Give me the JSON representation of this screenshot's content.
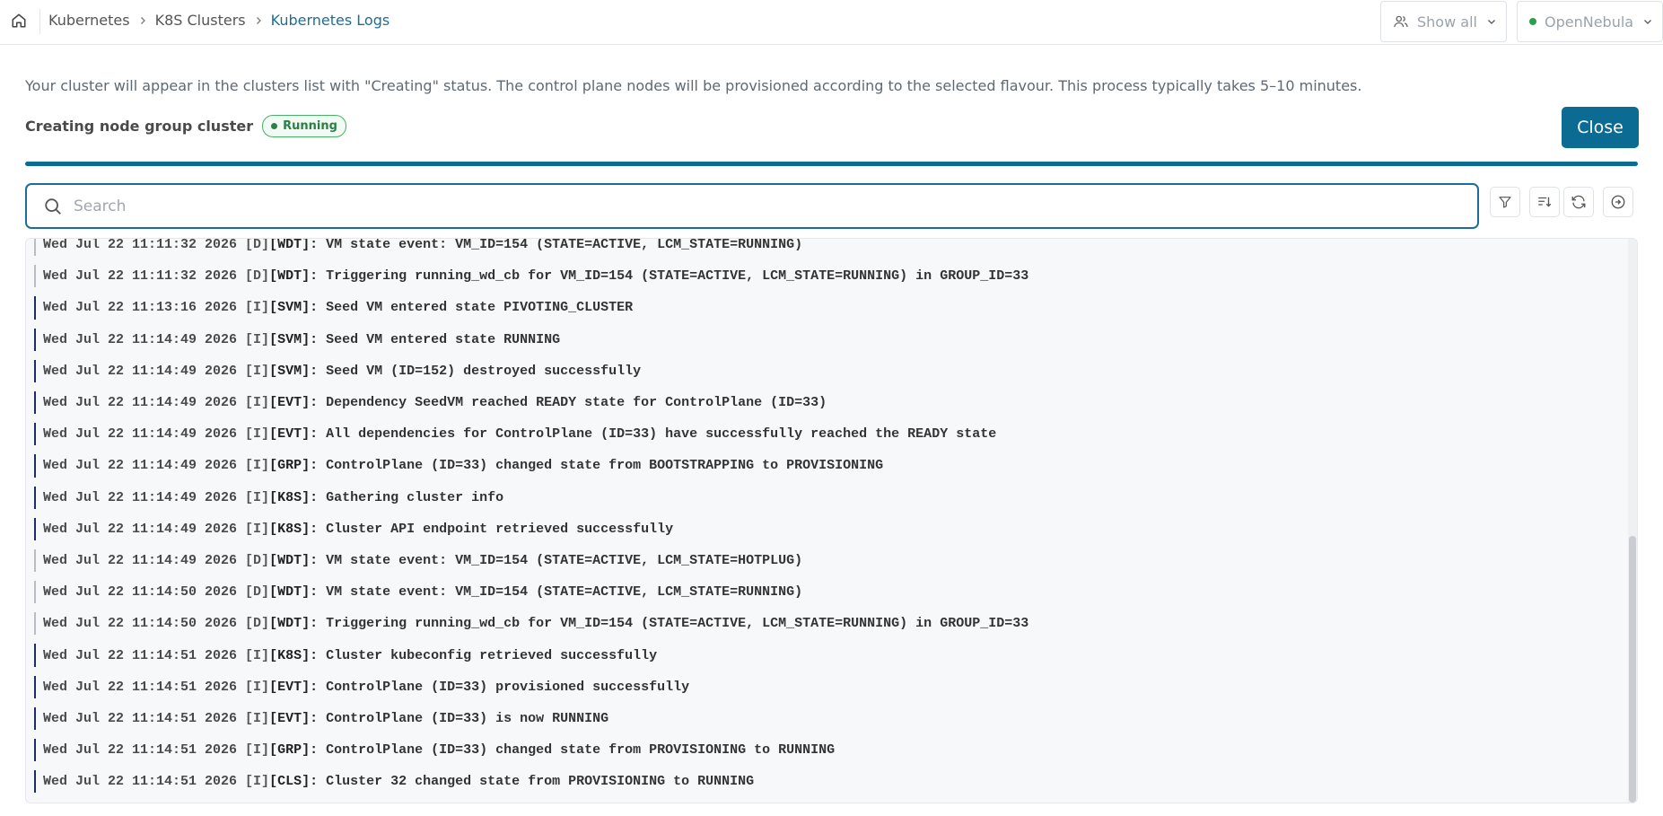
{
  "breadcrumb": {
    "items": [
      "Kubernetes",
      "K8S Clusters"
    ],
    "current": "Kubernetes Logs"
  },
  "header": {
    "show_all_label": "Show all",
    "cloud_label": "OpenNebula",
    "cloud_status_color": "#2e9e4f"
  },
  "info": {
    "message": "Your cluster will appear in the clusters list with \"Creating\" status. The control plane nodes will be provisioned according to the selected flavour. This process typically takes 5–10 minutes."
  },
  "status": {
    "title": "Creating node group cluster",
    "badge": "Running",
    "badge_color": "#2b7f45"
  },
  "close_label": "Close",
  "progress": {
    "fraction": 1.0,
    "color": "#0b6b93"
  },
  "search": {
    "placeholder": "Search",
    "value": ""
  },
  "toolbar": {
    "icons": [
      "filter-icon",
      "sort-icon",
      "refresh-icon",
      "follow-icon"
    ]
  },
  "logs": {
    "scroll_fraction": 1.0,
    "rows": [
      {
        "ts": "Wed Jul 22 11:11:32 2026",
        "level": "[D]",
        "component": "[WDT]:",
        "message": "VM state event: VM_ID=154 (STATE=ACTIVE, LCM_STATE=RUNNING)"
      },
      {
        "ts": "Wed Jul 22 11:11:32 2026",
        "level": "[D]",
        "component": "[WDT]:",
        "message": "Triggering running_wd_cb for VM_ID=154 (STATE=ACTIVE, LCM_STATE=RUNNING) in GROUP_ID=33"
      },
      {
        "ts": "Wed Jul 22 11:13:16 2026",
        "level": "[I]",
        "component": "[SVM]:",
        "message": "Seed VM entered state PIVOTING_CLUSTER"
      },
      {
        "ts": "Wed Jul 22 11:14:49 2026",
        "level": "[I]",
        "component": "[SVM]:",
        "message": "Seed VM entered state RUNNING"
      },
      {
        "ts": "Wed Jul 22 11:14:49 2026",
        "level": "[I]",
        "component": "[SVM]:",
        "message": "Seed VM (ID=152) destroyed successfully"
      },
      {
        "ts": "Wed Jul 22 11:14:49 2026",
        "level": "[I]",
        "component": "[EVT]:",
        "message": "Dependency SeedVM reached READY state for ControlPlane (ID=33)"
      },
      {
        "ts": "Wed Jul 22 11:14:49 2026",
        "level": "[I]",
        "component": "[EVT]:",
        "message": "All dependencies for ControlPlane (ID=33) have successfully reached the READY state"
      },
      {
        "ts": "Wed Jul 22 11:14:49 2026",
        "level": "[I]",
        "component": "[GRP]:",
        "message": "ControlPlane (ID=33) changed state from BOOTSTRAPPING to PROVISIONING"
      },
      {
        "ts": "Wed Jul 22 11:14:49 2026",
        "level": "[I]",
        "component": "[K8S]:",
        "message": "Gathering cluster info"
      },
      {
        "ts": "Wed Jul 22 11:14:49 2026",
        "level": "[I]",
        "component": "[K8S]:",
        "message": "Cluster API endpoint retrieved successfully"
      },
      {
        "ts": "Wed Jul 22 11:14:49 2026",
        "level": "[D]",
        "component": "[WDT]:",
        "message": "VM state event: VM_ID=154 (STATE=ACTIVE, LCM_STATE=HOTPLUG)"
      },
      {
        "ts": "Wed Jul 22 11:14:50 2026",
        "level": "[D]",
        "component": "[WDT]:",
        "message": "VM state event: VM_ID=154 (STATE=ACTIVE, LCM_STATE=RUNNING)"
      },
      {
        "ts": "Wed Jul 22 11:14:50 2026",
        "level": "[D]",
        "component": "[WDT]:",
        "message": "Triggering running_wd_cb for VM_ID=154 (STATE=ACTIVE, LCM_STATE=RUNNING) in GROUP_ID=33"
      },
      {
        "ts": "Wed Jul 22 11:14:51 2026",
        "level": "[I]",
        "component": "[K8S]:",
        "message": "Cluster kubeconfig retrieved successfully"
      },
      {
        "ts": "Wed Jul 22 11:14:51 2026",
        "level": "[I]",
        "component": "[EVT]:",
        "message": "ControlPlane (ID=33) provisioned successfully"
      },
      {
        "ts": "Wed Jul 22 11:14:51 2026",
        "level": "[I]",
        "component": "[EVT]:",
        "message": "ControlPlane (ID=33) is now RUNNING"
      },
      {
        "ts": "Wed Jul 22 11:14:51 2026",
        "level": "[I]",
        "component": "[GRP]:",
        "message": "ControlPlane (ID=33) changed state from PROVISIONING to RUNNING"
      },
      {
        "ts": "Wed Jul 22 11:14:51 2026",
        "level": "[I]",
        "component": "[CLS]:",
        "message": "Cluster 32 changed state from PROVISIONING to RUNNING"
      }
    ]
  }
}
